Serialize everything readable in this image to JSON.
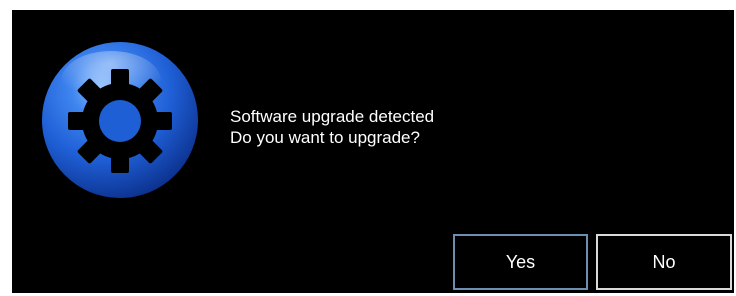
{
  "dialog": {
    "icon": "gear-icon",
    "message_line1": "Software upgrade detected",
    "message_line2": "Do you want to upgrade?",
    "yes_label": "Yes",
    "no_label": "No"
  },
  "colors": {
    "background": "#000000",
    "orb_blue": "#1f5fd6",
    "text": "#ffffff",
    "yes_border": "#6c8fb0",
    "no_border": "#d9d9d9"
  }
}
